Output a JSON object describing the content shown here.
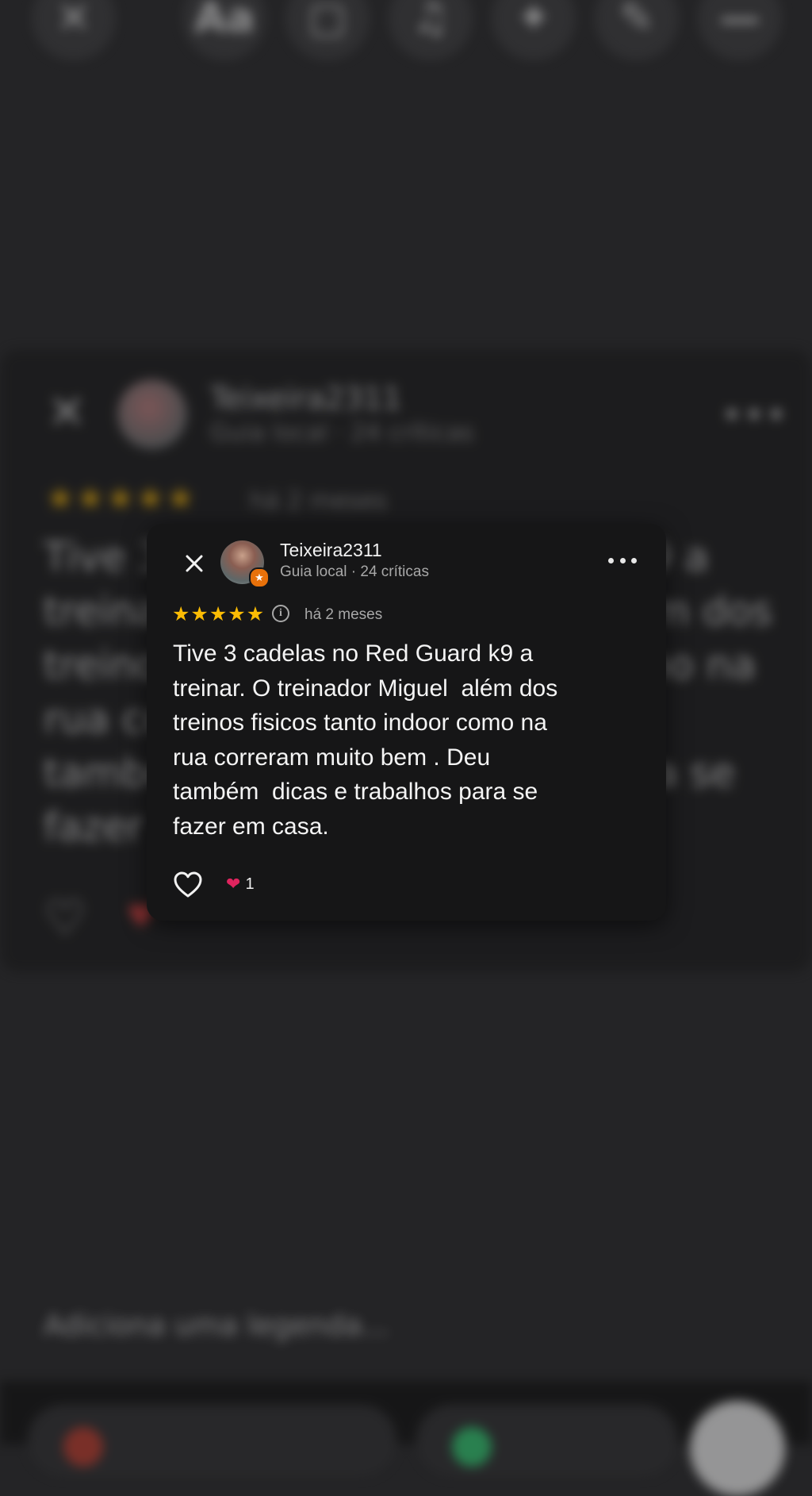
{
  "background": {
    "toolbar": [
      {
        "icon": "close-icon",
        "glyph": "✕"
      },
      {
        "icon": "text-style-icon",
        "glyph": "Aa"
      },
      {
        "icon": "sticker-icon",
        "glyph": "▢"
      },
      {
        "icon": "music-icon",
        "glyph": "♫"
      },
      {
        "icon": "effects-icon",
        "glyph": "✦"
      },
      {
        "icon": "draw-icon",
        "glyph": "✎"
      },
      {
        "icon": "more-icon",
        "glyph": "—"
      }
    ],
    "caption_placeholder": "Adiciona uma legenda..."
  },
  "review": {
    "author": "Teixeira2311",
    "meta": "Guia local · 24 críticas",
    "rating": 5,
    "time_ago": "há 2 meses",
    "text": "Tive 3 cadelas no Red Guard k9 a\ntreinar. O treinador Miguel  além dos\ntreinos fisicos tanto indoor como na\nrua correram muito bem . Deu\ntambém  dicas e trabalhos para se\nfazer em casa.",
    "reaction_count": "1"
  },
  "colors": {
    "star": "#fbbc04",
    "badge": "#e8710a",
    "reaction_heart": "#e0245e"
  }
}
